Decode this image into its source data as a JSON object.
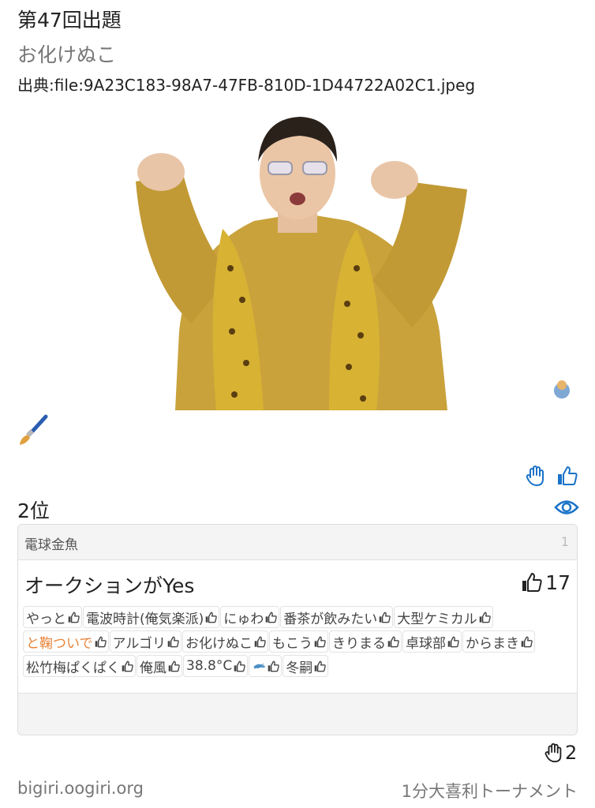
{
  "header": {
    "title": "第47回出題",
    "author": "お化けぬこ",
    "source": "出典:file:9A23C183-98A7-47FB-810D-1D44722A02C1.jpeg"
  },
  "icons": {
    "photo": "photo",
    "brush": "paintbrush-icon",
    "raise_hand": "raise-hand-icon",
    "like": "thumbs-up-icon",
    "eye": "eye-icon",
    "dolphin": "dolphin-emoji"
  },
  "colors": {
    "accent": "#1a73c8",
    "voter_highlight": "#e8843a"
  },
  "rank": "2位",
  "answer_card": {
    "author": "電球金魚",
    "number": "1",
    "answer_text": "オークションがYes",
    "likes": "17",
    "voters": [
      {
        "name": "やっと"
      },
      {
        "name": "電波時計(俺気楽派)"
      },
      {
        "name": "にゅわ"
      },
      {
        "name": "番茶が飲みたい"
      },
      {
        "name": "大型ケミカル"
      },
      {
        "name": "と鞠ついで",
        "highlight": true
      },
      {
        "name": "アルゴリ"
      },
      {
        "name": "お化けぬこ"
      },
      {
        "name": "もこう"
      },
      {
        "name": "きりまる"
      },
      {
        "name": "卓球部"
      },
      {
        "name": "からまき"
      },
      {
        "name": "松竹梅ぱくぱく"
      },
      {
        "name": "俺風"
      },
      {
        "name": "38.8°C"
      },
      {
        "name": "",
        "emoji": "dolphin"
      },
      {
        "name": "冬嗣"
      }
    ]
  },
  "raise_count": "2",
  "footer": {
    "site": "bigiri.oogiri.org",
    "tournament": "1分大喜利トーナメント"
  }
}
